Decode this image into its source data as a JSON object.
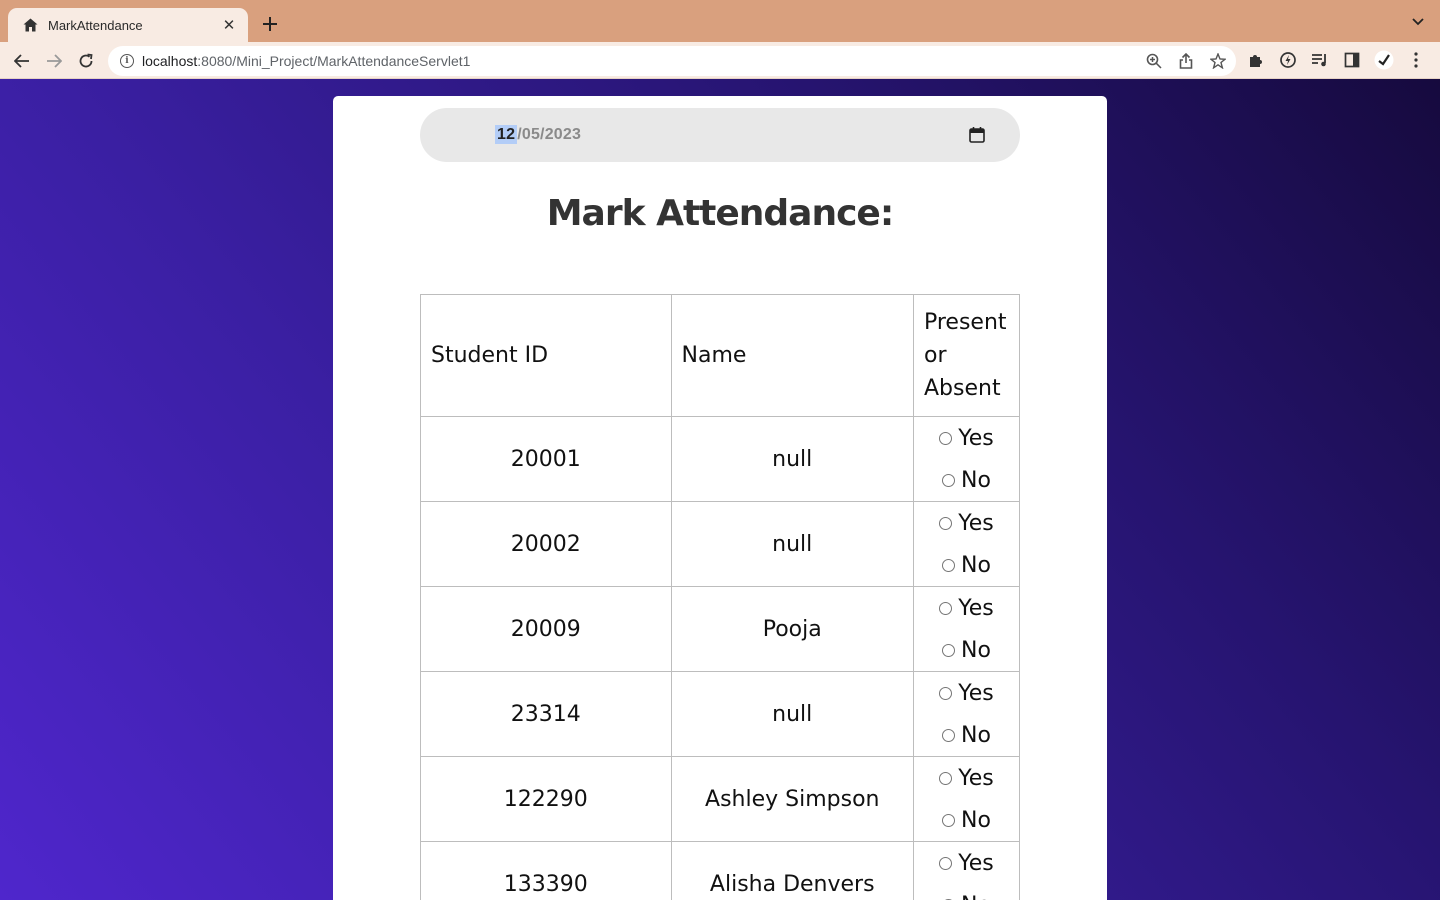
{
  "browser": {
    "tab_title": "MarkAttendance",
    "url_host": "localhost",
    "url_rest": ":8080/Mini_Project/MarkAttendanceServlet1"
  },
  "form": {
    "date_month": "12",
    "date_rest": "/05/2023",
    "heading": "Mark Attendance:"
  },
  "table": {
    "headers": [
      "Student ID",
      "Name",
      "Present or Absent"
    ],
    "yes_label": "Yes",
    "no_label": "No",
    "rows": [
      {
        "id": "20001",
        "name": "null"
      },
      {
        "id": "20002",
        "name": "null"
      },
      {
        "id": "20009",
        "name": "Pooja"
      },
      {
        "id": "23314",
        "name": "null"
      },
      {
        "id": "122290",
        "name": "Ashley Simpson"
      },
      {
        "id": "133390",
        "name": "Alisha Denvers"
      }
    ]
  },
  "colors": {
    "tabbar": "#d9a07e",
    "toolbar": "#f8ebe3",
    "bg_start": "#4f26cc",
    "bg_end": "#160a3e"
  }
}
